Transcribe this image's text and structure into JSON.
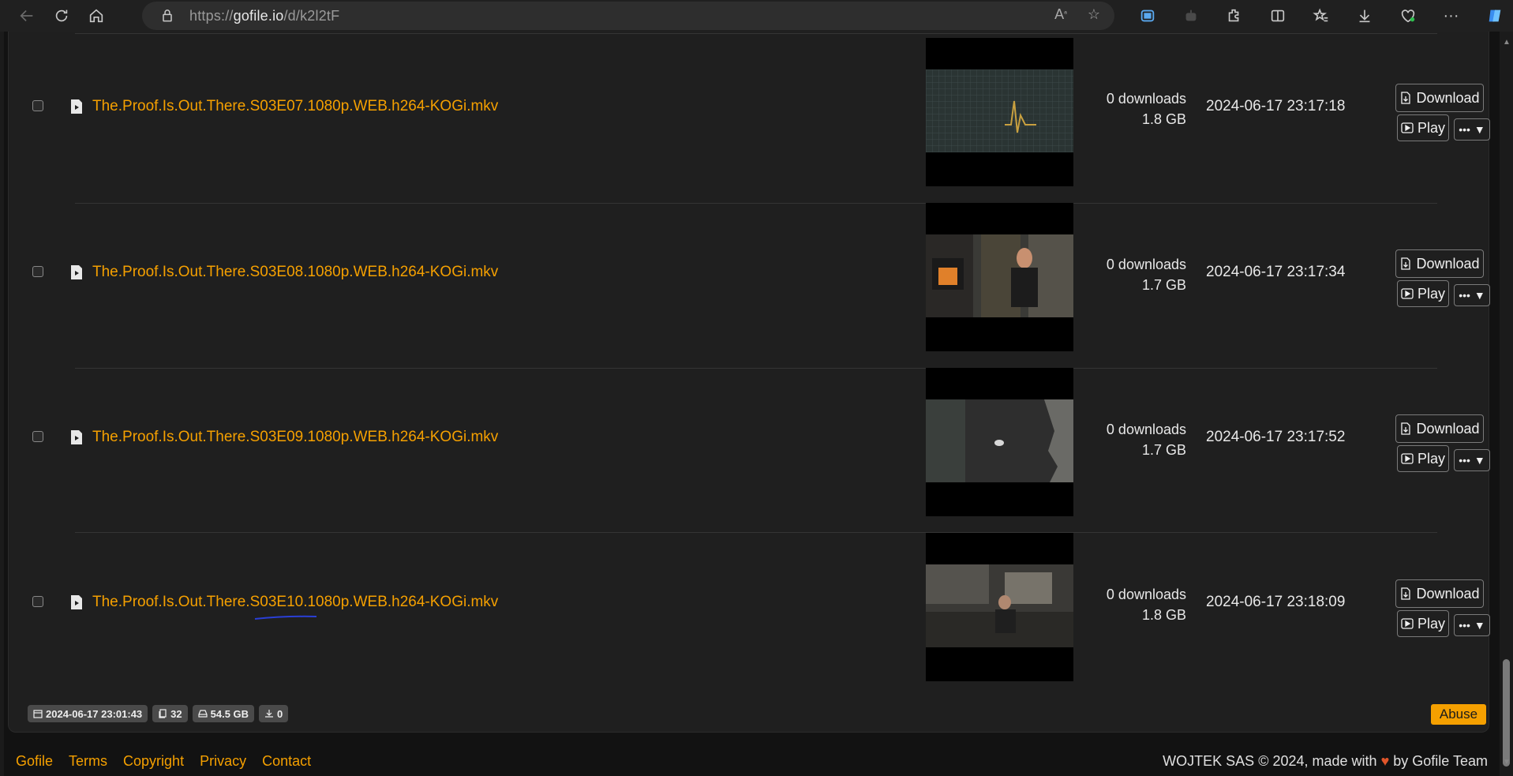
{
  "browser": {
    "url_prefix": "https://",
    "url_host": "gofile.io",
    "url_path": "/d/k2l2tF"
  },
  "files": [
    {
      "name": "The.Proof.Is.Out.There.S03E07.1080p.WEB.h264-KOGi.mkv",
      "downloads": "0 downloads",
      "size": "1.8 GB",
      "date": "2024-06-17 23:17:18"
    },
    {
      "name": "The.Proof.Is.Out.There.S03E08.1080p.WEB.h264-KOGi.mkv",
      "downloads": "0 downloads",
      "size": "1.7 GB",
      "date": "2024-06-17 23:17:34"
    },
    {
      "name": "The.Proof.Is.Out.There.S03E09.1080p.WEB.h264-KOGi.mkv",
      "downloads": "0 downloads",
      "size": "1.7 GB",
      "date": "2024-06-17 23:17:52"
    },
    {
      "name": "The.Proof.Is.Out.There.S03E10.1080p.WEB.h264-KOGi.mkv",
      "downloads": "0 downloads",
      "size": "1.8 GB",
      "date": "2024-06-17 23:18:09"
    }
  ],
  "buttons": {
    "download": "Download",
    "play": "Play",
    "more": "•••",
    "abuse": "Abuse"
  },
  "stats": {
    "created": "2024-06-17 23:01:43",
    "file_count": "32",
    "total_size": "54.5 GB",
    "downloads": "0"
  },
  "footer": {
    "links": [
      "Gofile",
      "Terms",
      "Copyright",
      "Privacy",
      "Contact"
    ],
    "credit_left": "WOJTEK SAS © 2024, made with",
    "credit_right": "by Gofile Team"
  },
  "colors": {
    "accent": "#f5a000",
    "background": "#1f1f1f"
  }
}
